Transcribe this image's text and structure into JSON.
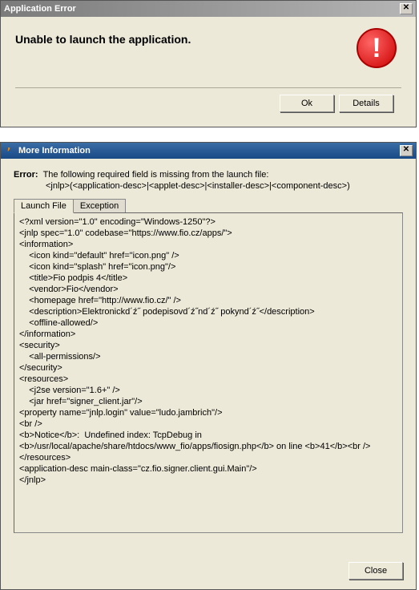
{
  "dialog1": {
    "title": "Application Error",
    "message": "Unable to launch the application.",
    "ok_label": "Ok",
    "details_label": "Details"
  },
  "dialog2": {
    "title": "More Information",
    "error_label": "Error:",
    "error_text": "The following required field is missing from the launch file:",
    "error_sub": "<jnlp>(<application-desc>|<applet-desc>|<installer-desc>|<component-desc>)",
    "tabs": [
      {
        "label": "Launch File"
      },
      {
        "label": "Exception"
      }
    ],
    "xml_content": "<?xml version=\"1.0\" encoding=\"Windows-1250\"?>\n<jnlp spec=\"1.0\" codebase=\"https://www.fio.cz/apps/\">\n<information>\n    <icon kind=\"default\" href=\"icon.png\" />\n    <icon kind=\"splash\" href=\"icon.png\"/>\n    <title>Fio podpis 4</title>\n    <vendor>Fio</vendor>\n    <homepage href=\"http://www.fio.cz/\" />\n    <description>Elektronickd´ź˝ podepisovd´ź˝nd´ź˝ pokynd´ź˝</description>\n    <offline-allowed/>\n</information>\n<security>\n    <all-permissions/>\n</security>\n<resources>\n    <j2se version=\"1.6+\" />\n    <jar href=\"signer_client.jar\"/>\n<property name=\"jnlp.login\" value=\"ludo.jambrich\"/>\n<br />\n<b>Notice</b>:  Undefined index: TcpDebug in <b>/usr/local/apache/share/htdocs/www_fio/apps/fiosign.php</b> on line <b>41</b><br />\n</resources>\n<application-desc main-class=\"cz.fio.signer.client.gui.Main\"/>\n</jnlp>",
    "close_label": "Close"
  }
}
